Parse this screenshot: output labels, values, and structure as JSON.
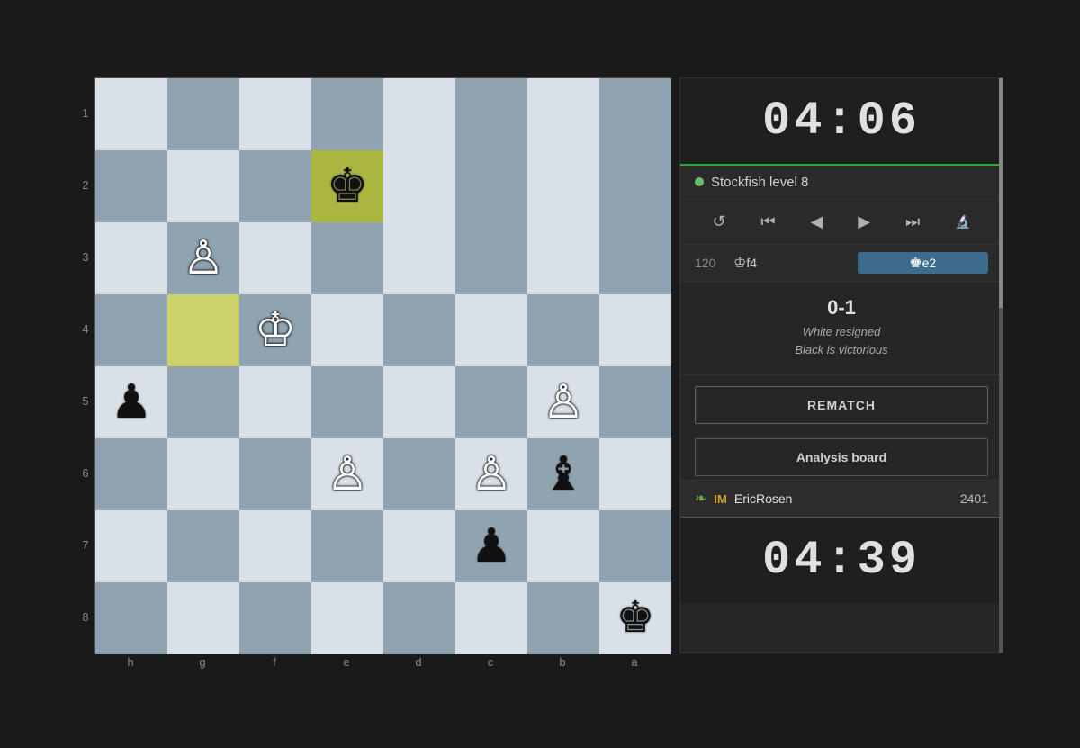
{
  "timers": {
    "top": "04:06",
    "bottom": "04:39"
  },
  "engine": {
    "name": "Stockfish level 8",
    "status_color": "#6abf69"
  },
  "controls": {
    "flip": "↺",
    "first": "⏮",
    "prev": "◀",
    "next": "▶",
    "last": "⏭",
    "analyze": "🔍"
  },
  "move": {
    "number": "120",
    "white": "♔f4",
    "black": "♚e2"
  },
  "result": {
    "score": "0-1",
    "line1": "White resigned",
    "line2": "Black is victorious"
  },
  "buttons": {
    "rematch": "REMATCH",
    "analysis": "Analysis board"
  },
  "player": {
    "title": "IM",
    "name": "EricRosen",
    "rating": "2401",
    "icon": "❧"
  },
  "board": {
    "files": [
      "h",
      "g",
      "f",
      "e",
      "d",
      "c",
      "b",
      "a"
    ],
    "ranks": [
      "1",
      "2",
      "3",
      "4",
      "5",
      "6",
      "7",
      "8"
    ]
  }
}
